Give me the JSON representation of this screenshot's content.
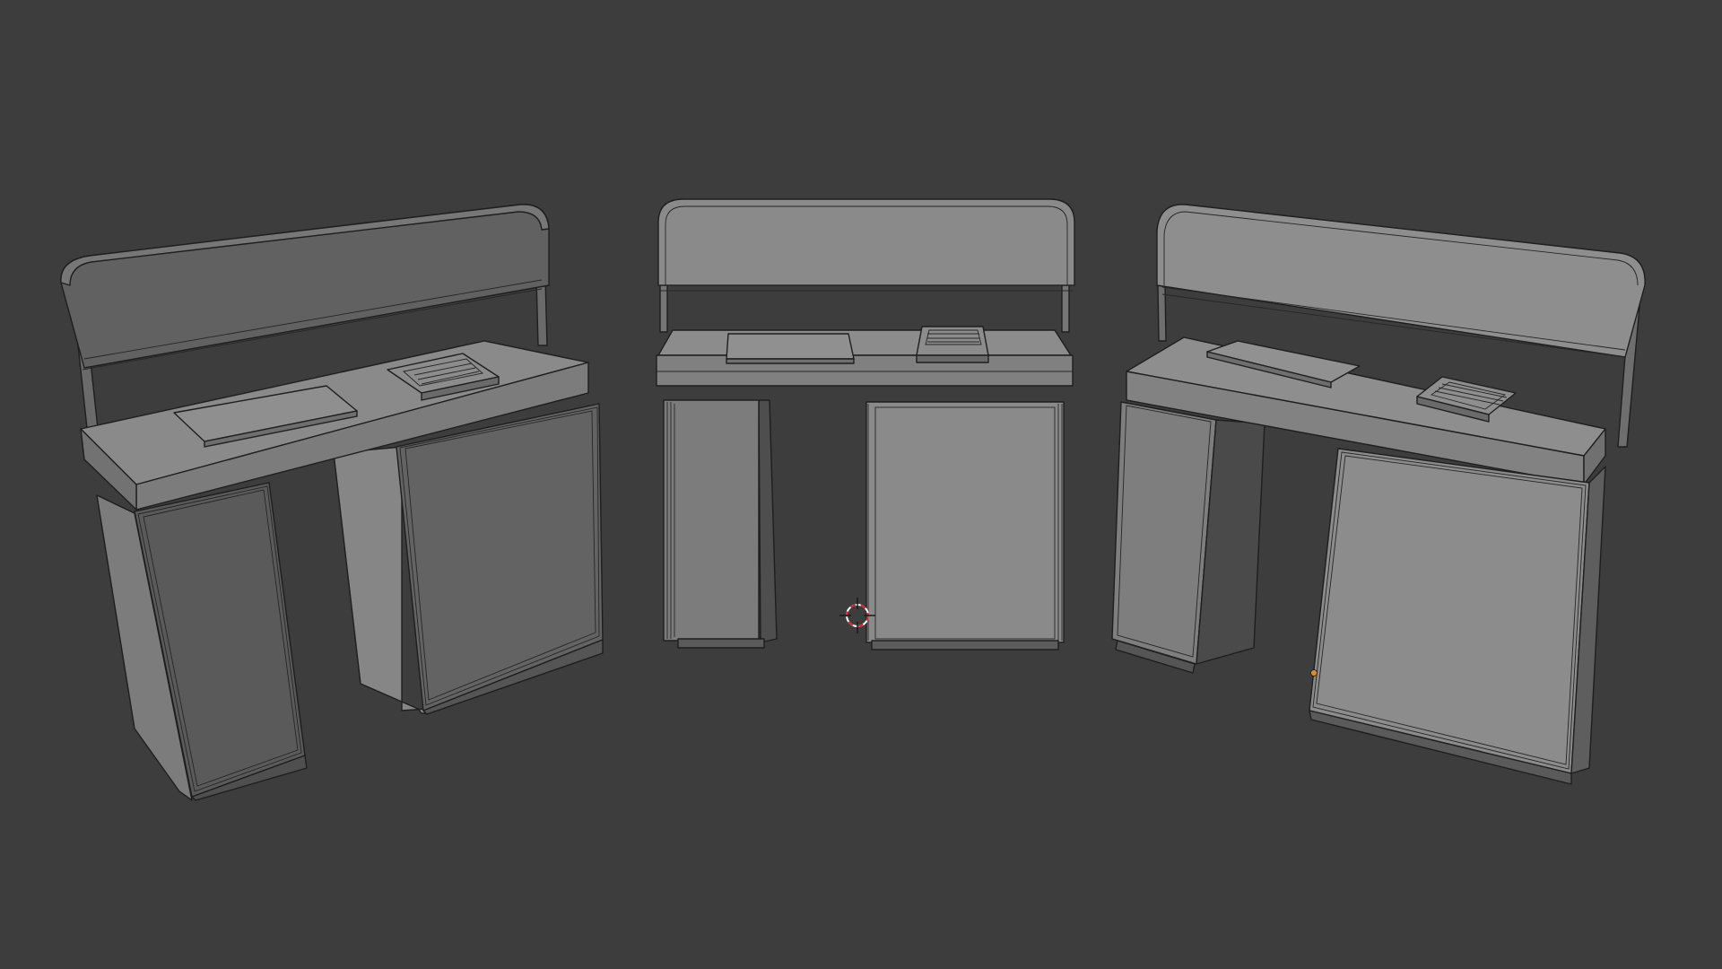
{
  "viewport": {
    "background": "#3d3d3d",
    "mode": "solid-shading-wireframe-overlay"
  },
  "scene": {
    "objects": [
      {
        "kind": "counter-desk",
        "view": "three-quarter-left",
        "selected": false
      },
      {
        "kind": "counter-desk",
        "view": "front",
        "selected": false
      },
      {
        "kind": "counter-desk",
        "view": "three-quarter-right",
        "selected": true
      }
    ]
  },
  "colors": {
    "surface_light": "#8e8e8e",
    "surface_mid": "#7a7a7a",
    "surface_dark": "#5f5f5f",
    "edge": "#1e1e1e",
    "cursor_red": "#d8272a",
    "selection_origin": "#e08a2b"
  },
  "icons": [
    "3d-cursor-icon",
    "object-origin-icon"
  ]
}
